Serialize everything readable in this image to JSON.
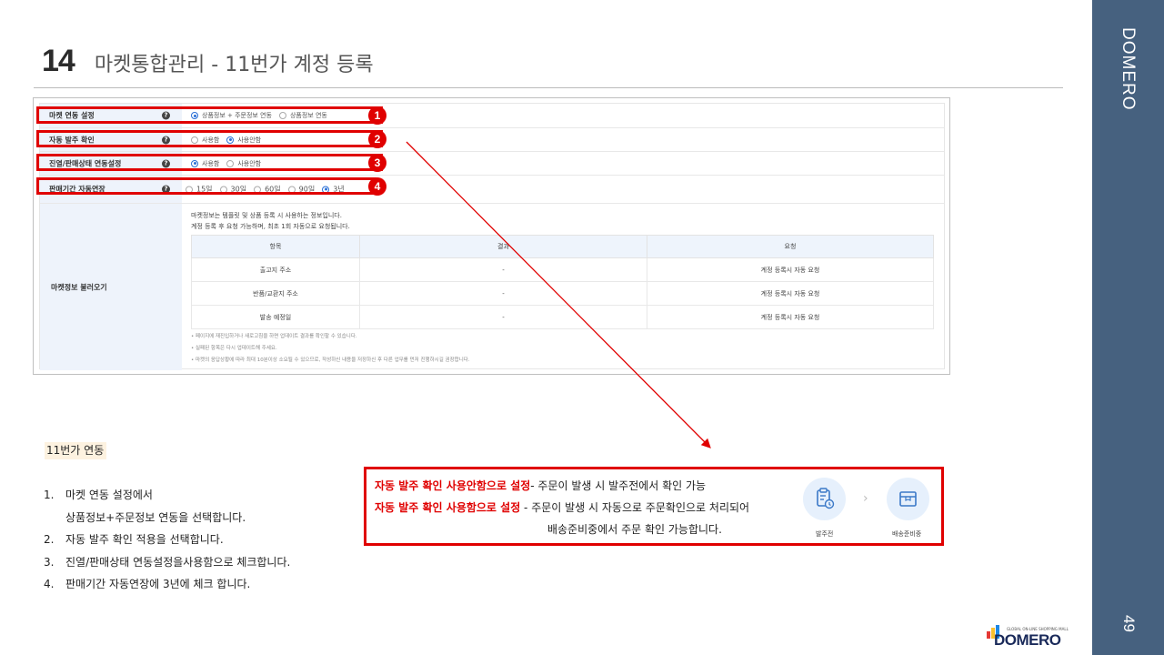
{
  "sidebar": {
    "brand": "DOMERO",
    "page_number": "49"
  },
  "header": {
    "number": "14",
    "title": "마켓통합관리 - 11번가 계정 등록"
  },
  "settings": {
    "rows": [
      {
        "label": "마켓 연동 설정",
        "options": [
          {
            "label": "상품정보 + 주문정보 연동",
            "selected": true
          },
          {
            "label": "상품정보 연동",
            "selected": false
          }
        ]
      },
      {
        "label": "자동 발주 확인",
        "options": [
          {
            "label": "사용함",
            "selected": false
          },
          {
            "label": "사용안함",
            "selected": true
          }
        ]
      },
      {
        "label": "진열/판매상태 연동설정",
        "options": [
          {
            "label": "사용함",
            "selected": true
          },
          {
            "label": "사용안함",
            "selected": false
          }
        ]
      },
      {
        "label": "판매기간 자동연장",
        "options": [
          {
            "label": "15일",
            "selected": false
          },
          {
            "label": "30일",
            "selected": false
          },
          {
            "label": "60일",
            "selected": false
          },
          {
            "label": "90일",
            "selected": false
          },
          {
            "label": "3년",
            "selected": true
          }
        ]
      }
    ],
    "badges": [
      "1",
      "2",
      "3",
      "4"
    ],
    "info": {
      "label": "마켓정보 불러오기",
      "desc1": "마켓정보는 템플릿 및 상품 등록 시 사용하는 정보입니다.",
      "desc2": "계정 등록 후 요청 가능하며, 최초 1회 자동으로 요청됩니다.",
      "table": {
        "headers": [
          "항목",
          "결과",
          "요청"
        ],
        "rows": [
          [
            "출고지 주소",
            "-",
            "계정 등록시 자동 요청"
          ],
          [
            "반품/교환지 주소",
            "-",
            "계정 등록시 자동 요청"
          ],
          [
            "발송 예정일",
            "-",
            "계정 등록시 자동 요청"
          ]
        ]
      },
      "notes": [
        "• 페이지에 재진입하거나 새로고침을 하면 업데이트 결과를 확인할 수 있습니다.",
        "• 실패된 항목은 다시 업데이트해 주세요.",
        "• 마켓의 응답상황에 따라 최대 10분이상 소요될 수 있으므로, 작성하신 내용을 저장하신 후 다른 업무를 먼저 진행하시길 권장합니다."
      ]
    }
  },
  "section_tag": "11번가 연동",
  "steps": [
    {
      "n": "1.",
      "text": "마켓 연동 설정에서"
    },
    {
      "n": "",
      "text": "상품정보+주문정보  연동을 선택합니다."
    },
    {
      "n": "2.",
      "text": "자동 발주 확인 적용을 선택합니다."
    },
    {
      "n": "3.",
      "text": "진열/판매상태  연동설정을사용함으로  체크합니다."
    },
    {
      "n": "4.",
      "text": "판매기간 자동연장에 3년에 체크 합니다."
    }
  ],
  "callout": {
    "line1_red": "자동 발주 확인 사용안함으로 설정",
    "line1_rest": "- 주문이 발생 시 발주전에서 확인 가능",
    "line2_red": "자동 발주 확인 사용함으로 설정",
    "line2_rest": " - 주문이 발생 시 자동으로 주문확인으로 처리되어",
    "line3": "배송준비중에서   주문 확인 가능합니다.",
    "icon1_label": "발주전",
    "icon2_label": "배송준비중"
  },
  "logo": {
    "tagline": "GLOBAL ON-LINE SHOPPING MALL",
    "name": "DOMERO"
  },
  "colors": {
    "sidebar": "#46617f",
    "highlight_red": "#e00000",
    "radio_on": "#2a6fd6"
  }
}
